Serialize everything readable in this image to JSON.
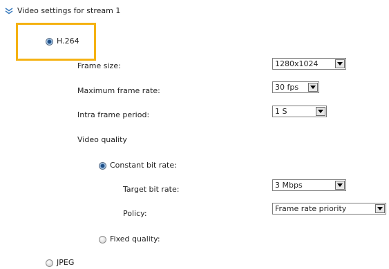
{
  "section": {
    "title": "Video settings for stream 1",
    "icon": "chevron-double-down-icon"
  },
  "codec": {
    "h264_label": "H.264",
    "h264_selected": true,
    "jpeg_label": "JPEG",
    "jpeg_selected": false
  },
  "fields": {
    "frame_size": {
      "label": "Frame size:",
      "value": "1280x1024"
    },
    "max_frame_rate": {
      "label": "Maximum frame rate:",
      "value": "30 fps"
    },
    "intra_frame_period": {
      "label": "Intra frame period:",
      "value": "1 S"
    }
  },
  "quality": {
    "heading": "Video quality",
    "constant_label": "Constant bit rate:",
    "constant_selected": true,
    "target_label": "Target bit rate:",
    "target_value": "3 Mbps",
    "policy_label": "Policy:",
    "policy_value": "Frame rate priority",
    "fixed_label": "Fixed quality:",
    "fixed_selected": false
  },
  "colors": {
    "highlight": "#f5b212",
    "chevron": "#3f7fc0",
    "radio_selected": "#1f4f86"
  }
}
